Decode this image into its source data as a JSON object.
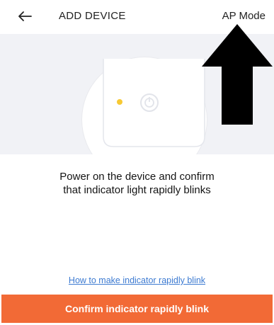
{
  "header": {
    "back_icon": "back-arrow-icon",
    "title": "ADD DEVICE",
    "mode_label": "AP Mode"
  },
  "illustration": {
    "indicator_color": "#f7c934",
    "icons": [
      "indicator-light-icon",
      "power-icon"
    ]
  },
  "annotation": {
    "arrow_icon": "arrow-up-icon",
    "color": "#000000"
  },
  "instruction": {
    "line1": "Power on the device and confirm",
    "line2": "that indicator light rapidly blinks"
  },
  "help_link": {
    "label": "How to make indicator rapidly blink",
    "color": "#3c7ad1"
  },
  "confirm_button": {
    "label": "Confirm indicator rapidly blink",
    "color": "#f26a36"
  }
}
